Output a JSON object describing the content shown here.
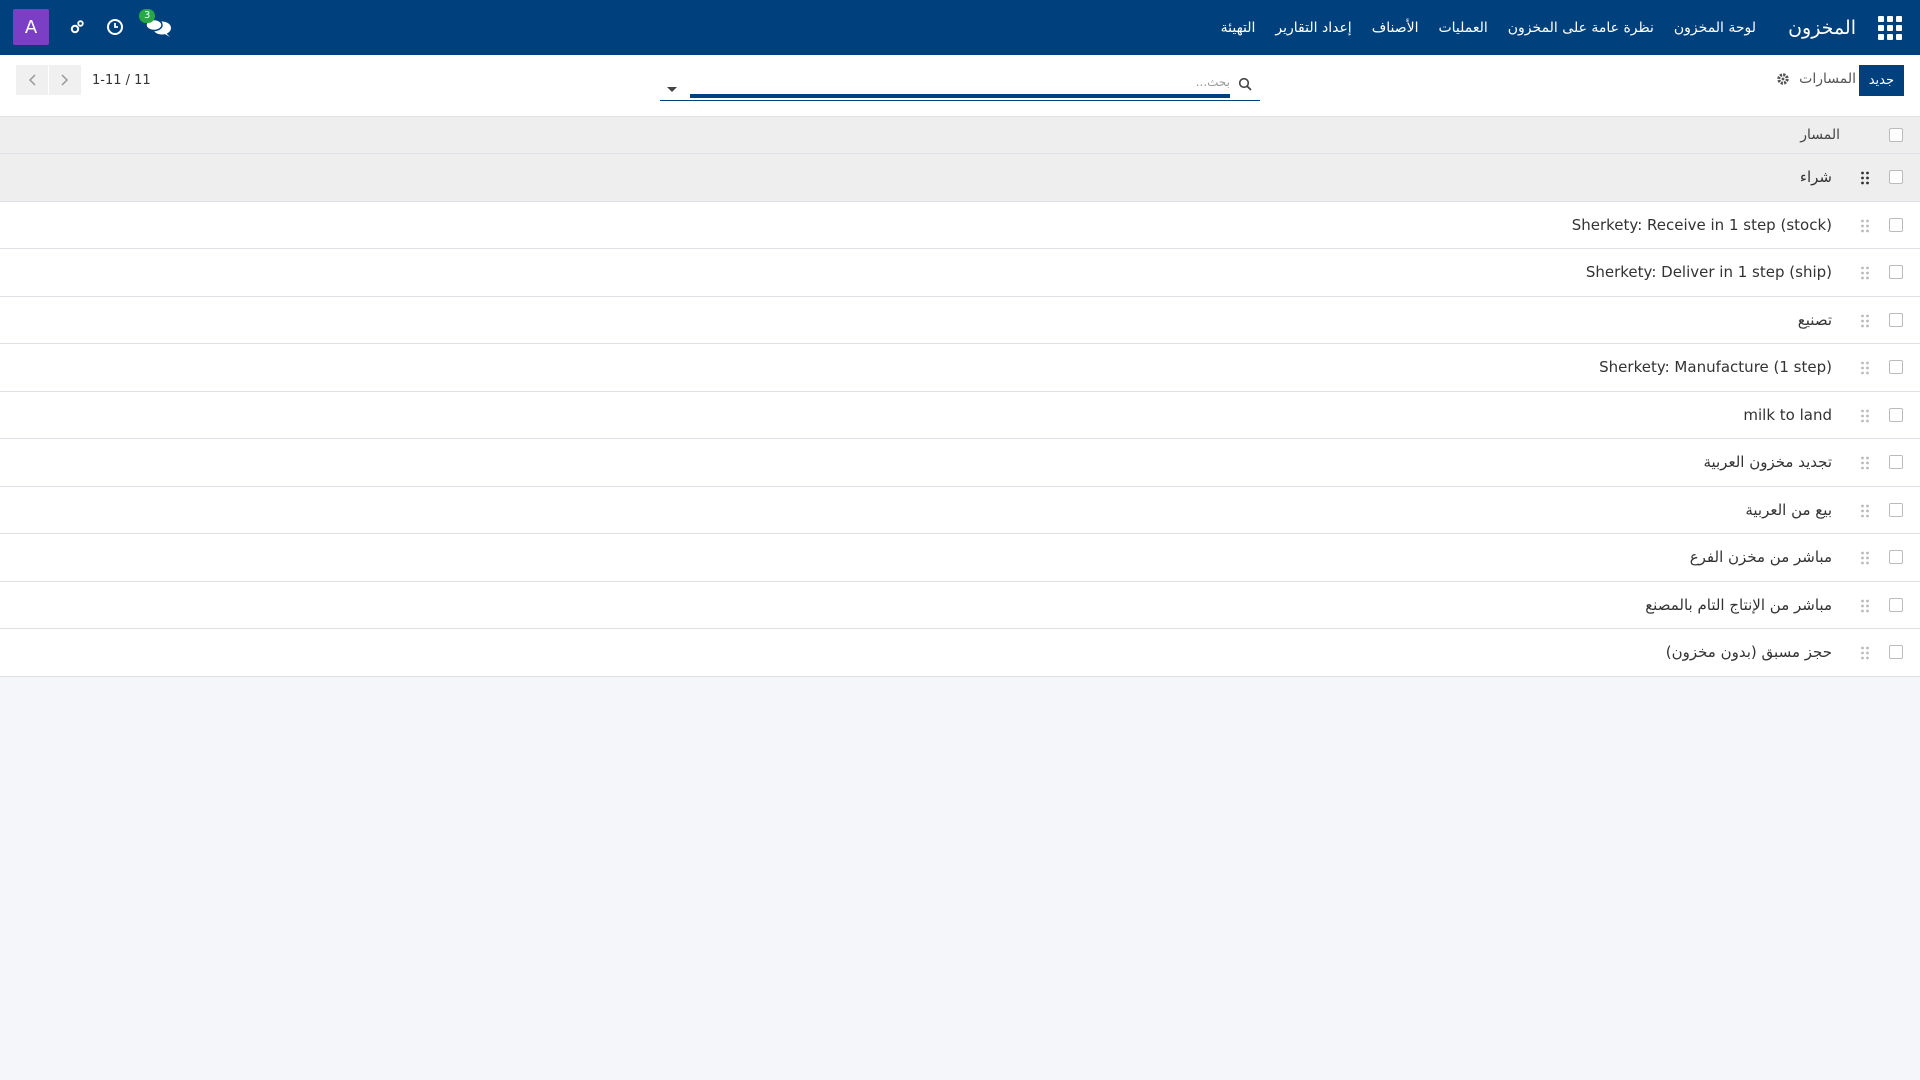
{
  "navbar": {
    "brand": "المخزون",
    "menu": [
      "لوحة المخزون",
      "نظرة عامة على المخزون",
      "العمليات",
      "الأصناف",
      "إعداد التقارير",
      "التهيئة"
    ],
    "avatar_letter": "A",
    "chat_badge": "3",
    "color": "#00417d"
  },
  "control_panel": {
    "new_label": "جديد",
    "title": "المسارات",
    "search_placeholder": "بحث...",
    "pager_value": "1-11 / 11"
  },
  "list": {
    "column_header": "المسار",
    "rows": [
      "شراء",
      "Sherkety: Receive in 1 step (stock)",
      "Sherkety: Deliver in 1 step (ship)",
      "تصنيع",
      "Sherkety: Manufacture (1 step)",
      "milk to land",
      "تجديد مخزون العربية",
      "بيع من العربية",
      "مباشر من مخزن الفرع",
      "مباشر من الإنتاج التام بالمصنع",
      "حجز مسبق (بدون مخزون)"
    ]
  }
}
